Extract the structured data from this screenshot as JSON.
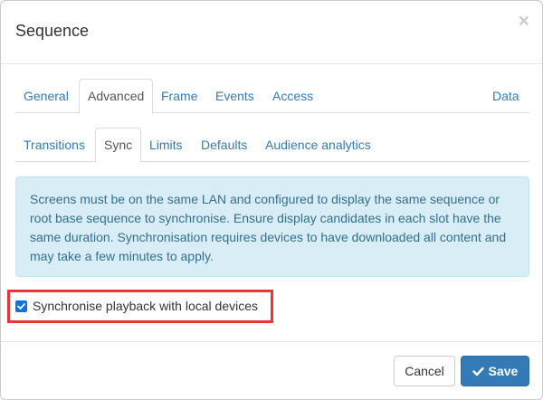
{
  "dialog": {
    "title": "Sequence",
    "close_glyph": "×"
  },
  "primary_tabs": [
    {
      "label": "General",
      "active": false
    },
    {
      "label": "Advanced",
      "active": true
    },
    {
      "label": "Frame",
      "active": false
    },
    {
      "label": "Events",
      "active": false
    },
    {
      "label": "Access",
      "active": false
    },
    {
      "label": "Data",
      "active": false
    }
  ],
  "secondary_tabs": [
    {
      "label": "Transitions",
      "active": false
    },
    {
      "label": "Sync",
      "active": true
    },
    {
      "label": "Limits",
      "active": false
    },
    {
      "label": "Defaults",
      "active": false
    },
    {
      "label": "Audience analytics",
      "active": false
    }
  ],
  "info": {
    "text": "Screens must be on the same LAN and configured to display the same sequence or root base sequence to synchronise. Ensure display candidates in each slot have the same duration. Synchronisation requires devices to have downloaded all content and may take a few minutes to apply."
  },
  "sync_option": {
    "label": "Synchronise playback with local devices",
    "checked": true
  },
  "footer": {
    "cancel_label": "Cancel",
    "save_label": "Save"
  },
  "colors": {
    "link": "#337ab7",
    "info_bg": "#d9edf7",
    "info_text": "#31708f",
    "highlight": "#e8353a",
    "primary_button": "#337ab7"
  },
  "icons": {
    "close": "close-icon",
    "checkbox": "checkbox-checked-icon",
    "save": "check-icon"
  }
}
